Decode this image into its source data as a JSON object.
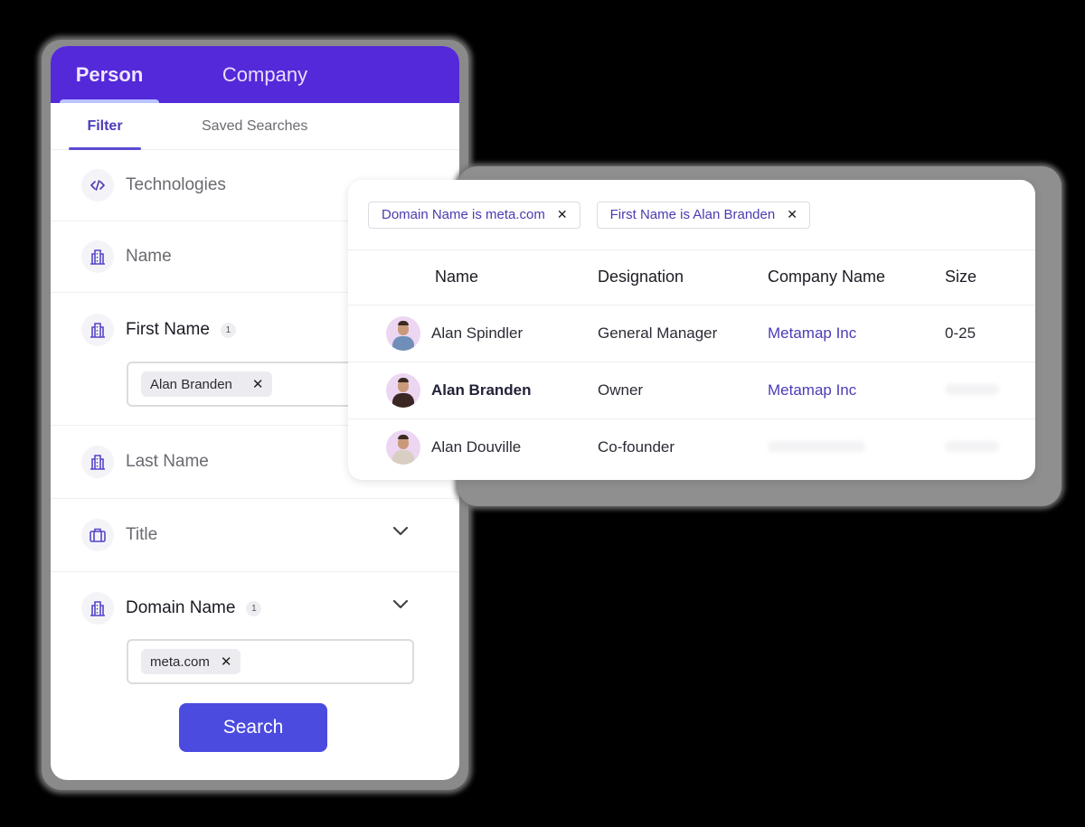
{
  "colors": {
    "header_bg": "#5429d9",
    "accent": "#4b3cb6",
    "search_button": "#4b4be0",
    "page_bg": "#000000"
  },
  "filter_panel": {
    "top_tabs": [
      {
        "label": "Person",
        "active": true
      },
      {
        "label": "Company",
        "active": false
      }
    ],
    "sub_tabs": [
      {
        "label": "Filter",
        "active": true
      },
      {
        "label": "Saved Searches",
        "active": false
      }
    ],
    "filters": [
      {
        "label": "Technologies",
        "icon": "code-icon"
      },
      {
        "label": "Name",
        "icon": "building-icon"
      },
      {
        "label": "First Name",
        "icon": "building-icon",
        "count": "1",
        "chips": [
          "Alan Branden"
        ]
      },
      {
        "label": "Last Name",
        "icon": "building-icon"
      },
      {
        "label": "Title",
        "icon": "briefcase-icon",
        "expandable": true
      },
      {
        "label": "Domain Name",
        "icon": "building-icon",
        "count": "1",
        "expandable": true,
        "chips": [
          "meta.com"
        ]
      }
    ],
    "search_label": "Search"
  },
  "results": {
    "applied_filters": [
      {
        "label": "Domain Name is meta.com"
      },
      {
        "label": "First Name is Alan Branden"
      }
    ],
    "columns": [
      "Name",
      "Designation",
      "Company Name",
      "Size"
    ],
    "rows": [
      {
        "name": "Alan Spindler",
        "designation": "General Manager",
        "company": "Metamap Inc",
        "size": "0-25",
        "bold": false
      },
      {
        "name": "Alan Branden",
        "designation": "Owner",
        "company": "Metamap Inc",
        "size": null,
        "bold": true
      },
      {
        "name": "Alan Douville",
        "designation": "Co-founder",
        "company": null,
        "size": null,
        "bold": false
      }
    ]
  }
}
